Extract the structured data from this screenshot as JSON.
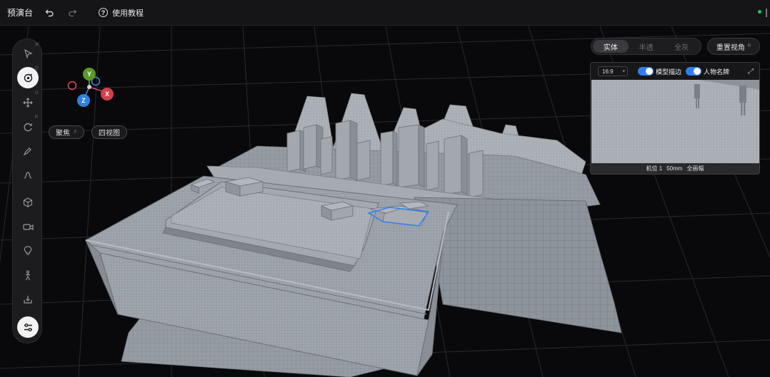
{
  "topbar": {
    "title": "预演台",
    "tutorial_label": "使用教程",
    "undo_icon": "undo-icon",
    "redo_icon": "redo-icon",
    "status_color": "#22c55e"
  },
  "left_toolbar": {
    "tools": [
      {
        "name": "select-tool",
        "icon": "cursor-icon",
        "key": "W"
      },
      {
        "name": "orbit-tool",
        "icon": "orbit-icon",
        "key": "Q"
      },
      {
        "name": "move-tool",
        "icon": "move-icon",
        "key": "G"
      },
      {
        "name": "rotate-tool",
        "icon": "rotate-icon",
        "key": "R"
      },
      {
        "name": "paint-tool",
        "icon": "brush-icon",
        "key": ""
      },
      {
        "name": "path-tool",
        "icon": "path-icon",
        "key": ""
      },
      {
        "name": "model-tool",
        "icon": "cube-icon",
        "key": ""
      },
      {
        "name": "camera-tool",
        "icon": "camera-icon",
        "key": ""
      },
      {
        "name": "light-tool",
        "icon": "bulb-icon",
        "key": ""
      },
      {
        "name": "character-tool",
        "icon": "person-icon",
        "key": ""
      },
      {
        "name": "import-tool",
        "icon": "import-icon",
        "key": ""
      },
      {
        "name": "settings-tool",
        "icon": "sliders-icon",
        "key": ""
      }
    ]
  },
  "gizmo": {
    "y": "Y",
    "z": "Z",
    "x": "X"
  },
  "view_buttons": {
    "focus_label": "聚焦",
    "focus_key": "F",
    "four_view_label": "四视图"
  },
  "render_mode": {
    "options": [
      "实体",
      "半透",
      "全灰"
    ],
    "selected": "实体"
  },
  "reset_view": {
    "label": "重置视角",
    "key": "R"
  },
  "preview": {
    "ratio": "16:9",
    "toggle_model_edge": "模型描边",
    "toggle_character_name": "人物名牌",
    "caption_position": "机位 1",
    "caption_lens": "50mm",
    "caption_shot": "全画幅",
    "accent_color": "#2f7ff0"
  }
}
